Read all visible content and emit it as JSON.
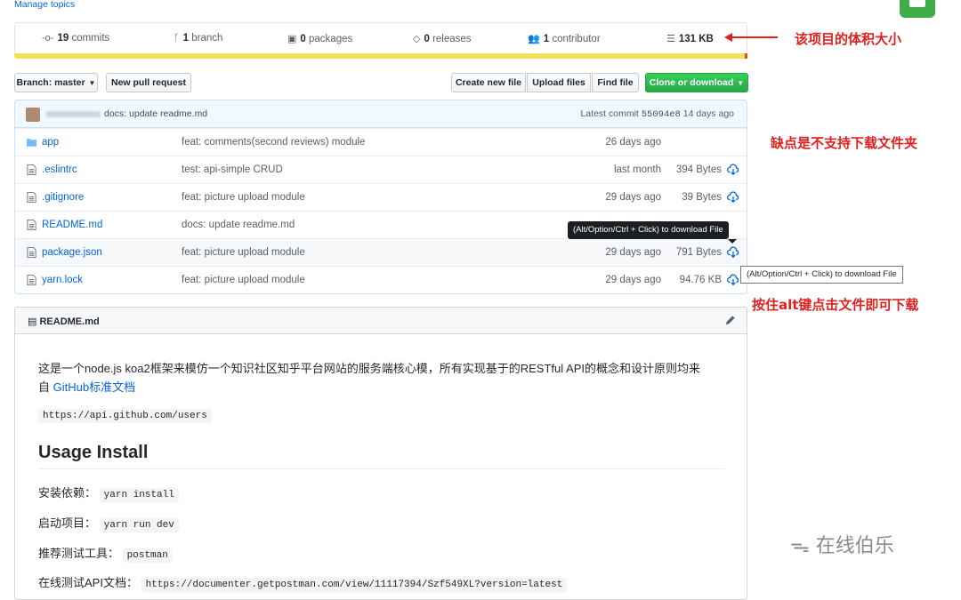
{
  "top": {
    "manage_topics": "Manage topics"
  },
  "stats": {
    "commits": {
      "count": "19",
      "label": "commits"
    },
    "branch": {
      "count": "1",
      "label": "branch"
    },
    "packages": {
      "count": "0",
      "label": "packages"
    },
    "releases": {
      "count": "0",
      "label": "releases"
    },
    "contributor": {
      "count": "1",
      "label": "contributor"
    },
    "size": "131 KB"
  },
  "toolbar": {
    "branch_label": "Branch: master",
    "new_pull_request": "New pull request",
    "create_new_file": "Create new file",
    "upload_files": "Upload files",
    "find_file": "Find file",
    "clone_or_download": "Clone or download"
  },
  "latest_commit": {
    "message": "docs: update readme.md",
    "prefix": "Latest commit",
    "sha": "55094e8",
    "age": "14 days ago"
  },
  "files": [
    {
      "name": "app",
      "type": "folder",
      "message": "feat: comments(second reviews) module",
      "age": "26 days ago",
      "size": ""
    },
    {
      "name": ".eslintrc",
      "type": "file",
      "message": "test: api-simple CRUD",
      "age": "last month",
      "size": "394 Bytes"
    },
    {
      "name": ".gitignore",
      "type": "file",
      "message": "feat: picture upload module",
      "age": "29 days ago",
      "size": "39 Bytes"
    },
    {
      "name": "README.md",
      "type": "file",
      "message": "docs: update readme.md",
      "age": "",
      "size": ""
    },
    {
      "name": "package.json",
      "type": "file",
      "message": "feat: picture upload module",
      "age": "29 days ago",
      "size": "791 Bytes"
    },
    {
      "name": "yarn.lock",
      "type": "file",
      "message": "feat: picture upload module",
      "age": "29 days ago",
      "size": "94.76 KB"
    }
  ],
  "tooltips": {
    "dark": "(Alt/Option/Ctrl + Click) to download File",
    "light": "(Alt/Option/Ctrl + Click) to download File"
  },
  "readme": {
    "title": "README.md",
    "intro_line1": "这是一个node.js koa2框架来模仿一个知识社区知乎平台网站的服务端核心模，所有实现基于的RESTful API的概念和设计原则均来",
    "intro_line2_prefix": "自 ",
    "intro_link": "GitHub标准文档",
    "api_url": "https://api.github.com/users",
    "heading": "Usage Install",
    "install_label": "安装依赖：",
    "install_cmd": "yarn install",
    "start_label": "启动项目：",
    "start_cmd": "yarn run dev",
    "tool_label": "推荐测试工具：",
    "tool_cmd": "postman",
    "doc_label": "在线测试API文档：",
    "doc_url": "https://documenter.getpostman.com/view/11117394/Szf549XL?version=latest"
  },
  "annotations": {
    "size_note": "该项目的体积大小",
    "folder_note": "缺点是不支持下载文件夹",
    "alt_note": "按住alt键点击文件即可下载"
  },
  "watermark": "在线伯乐",
  "colors": {
    "accent_red": "#e01f1f",
    "link_blue": "#0366d6",
    "clone_green": "#28a745",
    "lang_yellow": "#f1e05a"
  }
}
